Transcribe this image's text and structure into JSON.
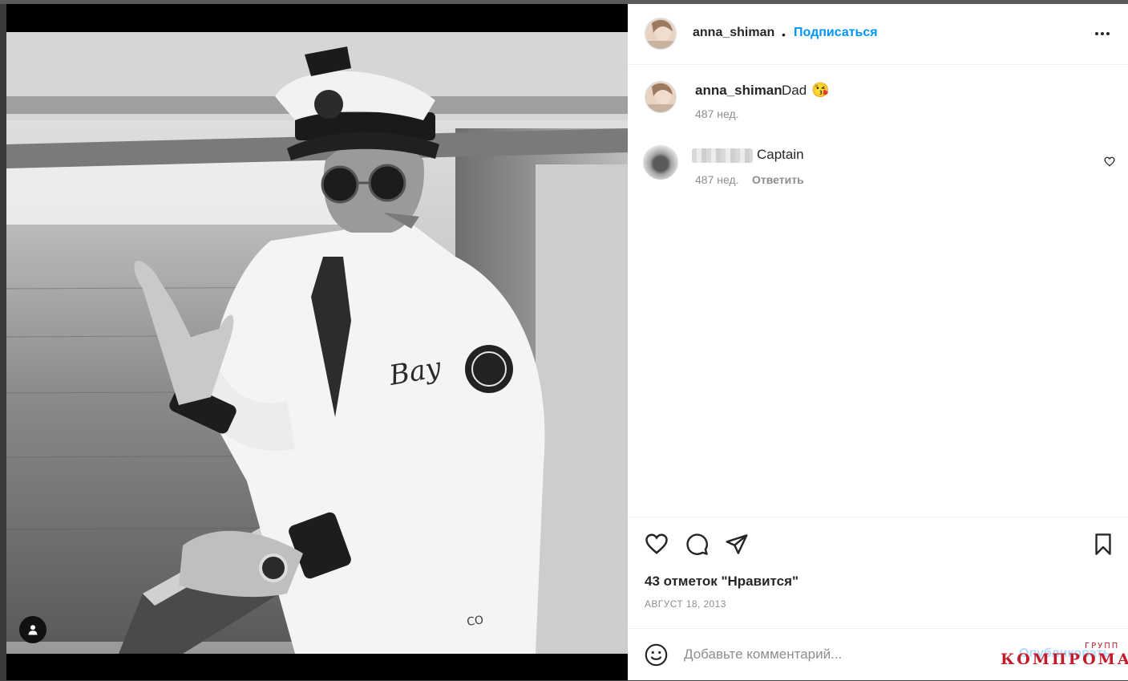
{
  "post": {
    "username": "anna_shiman",
    "follow_label": "Подписаться",
    "separator": "•"
  },
  "caption": {
    "username": "anna_shiman",
    "text": "Dad",
    "emoji": "😘",
    "time": "487 нед."
  },
  "comment": {
    "text": "Captain",
    "time": "487 нед.",
    "reply_label": "Ответить"
  },
  "stats": {
    "likes": "43 отметок \"Нравится\"",
    "date": "АВГУСТ 18, 2013"
  },
  "comment_bar": {
    "placeholder": "Добавьте комментарий...",
    "publish_label": "Опубликовать"
  },
  "watermark": {
    "main": "КОМПРОМАТ",
    "small": "ГРУПП"
  },
  "icons": {
    "more": "more-options-icon",
    "like": "heart-icon",
    "comment": "comment-icon",
    "share": "paper-plane-icon",
    "save": "bookmark-icon",
    "emoji": "smiley-icon",
    "tag": "user-tag-icon"
  },
  "colors": {
    "accent": "#0095f6",
    "text": "#262626",
    "muted": "#8e8e8e",
    "watermark": "#c21c2a"
  }
}
